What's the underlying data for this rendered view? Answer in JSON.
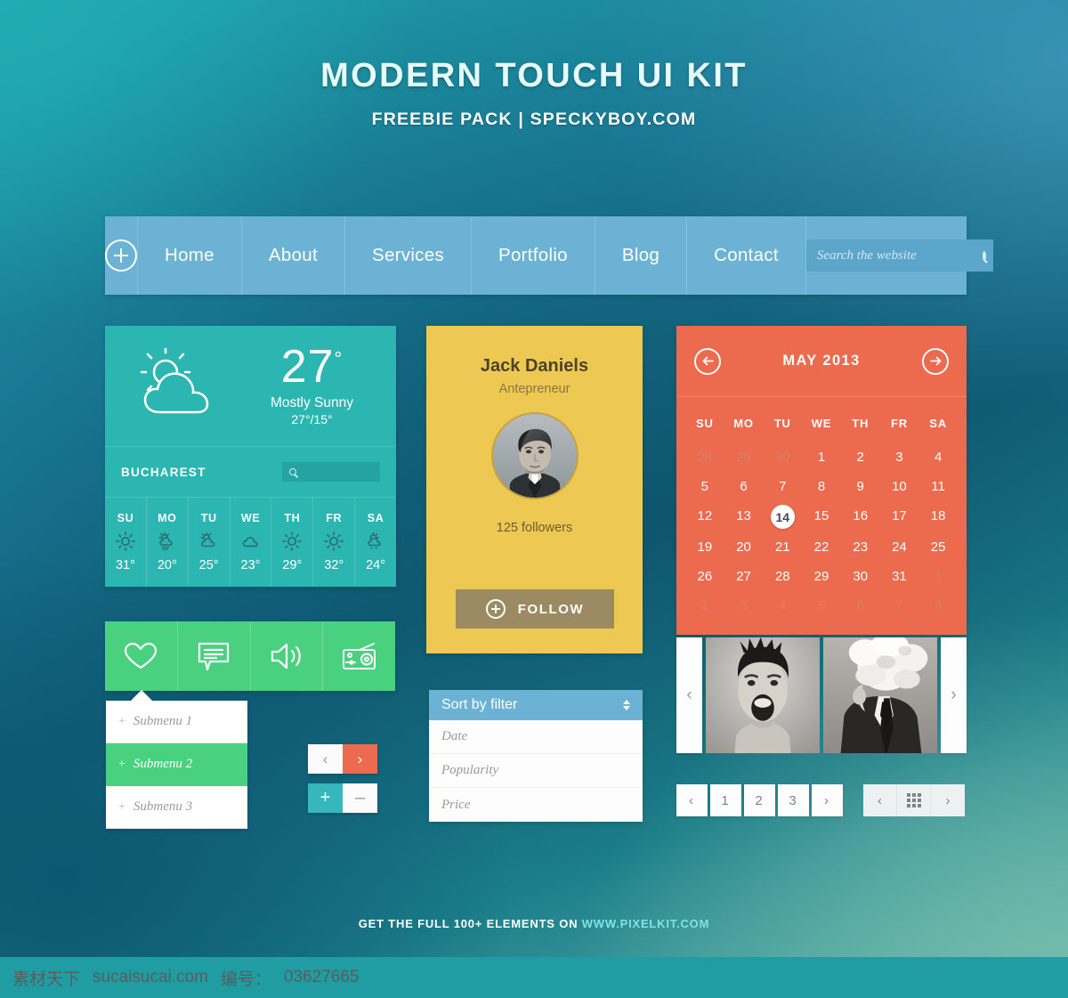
{
  "header": {
    "title": "MODERN TOUCH UI KIT",
    "subtitle": "FREEBIE PACK | SPECKYBOY.COM"
  },
  "nav": {
    "plus_icon": "plus-circle-icon",
    "items": [
      {
        "label": "Home"
      },
      {
        "label": "About"
      },
      {
        "label": "Services"
      },
      {
        "label": "Portfolio"
      },
      {
        "label": "Blog"
      },
      {
        "label": "Contact"
      }
    ],
    "search": {
      "placeholder": "Search the website",
      "value": "",
      "icon": "search-icon"
    },
    "bar_color": "#6cb2d4"
  },
  "weather": {
    "icon": "sun-behind-cloud-icon",
    "temperature": "27",
    "degree": "°",
    "condition": "Mostly Sunny",
    "high_low": "27°/15°",
    "city": "BUCHAREST",
    "search_placeholder": "",
    "search_icon": "search-icon",
    "card_color": "#2cb6b2",
    "days": [
      {
        "day": "SU",
        "icon": "sun-icon",
        "temp": "31°"
      },
      {
        "day": "MO",
        "icon": "sun-rain-icon",
        "temp": "20°"
      },
      {
        "day": "TU",
        "icon": "sun-cloud-icon",
        "temp": "25°"
      },
      {
        "day": "WE",
        "icon": "cloud-icon",
        "temp": "23°"
      },
      {
        "day": "TH",
        "icon": "sun-icon",
        "temp": "29°"
      },
      {
        "day": "FR",
        "icon": "sun-icon",
        "temp": "32°"
      },
      {
        "day": "SA",
        "icon": "sun-cloud-rain-icon",
        "temp": "24°"
      }
    ]
  },
  "profile": {
    "name": "Jack Daniels",
    "role": "Antepreneur",
    "avatar": "user-photo-avatar",
    "followers": "125 followers",
    "follow_label": "FOLLOW",
    "follow_icon": "plus-circle-icon",
    "card_color": "#edc954",
    "button_color": "#9c8a62"
  },
  "calendar": {
    "prev_icon": "arrow-left-circle-icon",
    "next_icon": "arrow-right-circle-icon",
    "title": "MAY 2013",
    "card_color": "#ec6a4d",
    "dow": [
      "SU",
      "MO",
      "TU",
      "WE",
      "TH",
      "FR",
      "SA"
    ],
    "weeks": [
      [
        {
          "d": "28",
          "muted": true
        },
        {
          "d": "29",
          "muted": true
        },
        {
          "d": "30",
          "muted": true
        },
        {
          "d": "1"
        },
        {
          "d": "2"
        },
        {
          "d": "3"
        },
        {
          "d": "4"
        }
      ],
      [
        {
          "d": "5"
        },
        {
          "d": "6"
        },
        {
          "d": "7"
        },
        {
          "d": "8"
        },
        {
          "d": "9"
        },
        {
          "d": "10"
        },
        {
          "d": "11"
        }
      ],
      [
        {
          "d": "12"
        },
        {
          "d": "13"
        },
        {
          "d": "14",
          "selected": true
        },
        {
          "d": "15"
        },
        {
          "d": "16"
        },
        {
          "d": "17"
        },
        {
          "d": "18"
        }
      ],
      [
        {
          "d": "19"
        },
        {
          "d": "20"
        },
        {
          "d": "21"
        },
        {
          "d": "22"
        },
        {
          "d": "23"
        },
        {
          "d": "24"
        },
        {
          "d": "25"
        }
      ],
      [
        {
          "d": "26"
        },
        {
          "d": "27"
        },
        {
          "d": "28"
        },
        {
          "d": "29"
        },
        {
          "d": "30"
        },
        {
          "d": "31"
        },
        {
          "d": "1",
          "muted": true
        }
      ],
      [
        {
          "d": "2",
          "muted": true
        },
        {
          "d": "3",
          "muted": true
        },
        {
          "d": "4",
          "muted": true
        },
        {
          "d": "5",
          "muted": true
        },
        {
          "d": "6",
          "muted": true
        },
        {
          "d": "7",
          "muted": true
        },
        {
          "d": "8",
          "muted": true
        }
      ]
    ]
  },
  "greenbar": {
    "color": "#4ad17f",
    "icons": [
      "heart-icon",
      "chat-bubble-icon",
      "speaker-volume-icon",
      "radio-icon"
    ]
  },
  "submenu": {
    "items": [
      {
        "prefix": "+",
        "label": "Submenu 1",
        "active": false
      },
      {
        "prefix": "+",
        "label": "Submenu 2",
        "active": true
      },
      {
        "prefix": "+",
        "label": "Submenu 3",
        "active": false
      }
    ],
    "active_color": "#4ad17f"
  },
  "steppers": {
    "nav": {
      "prev": "‹",
      "next": "›",
      "next_color": "#ec6a4d"
    },
    "plusminus": {
      "plus": "+",
      "minus": "–",
      "plus_color": "#35b7bd"
    }
  },
  "sort": {
    "header_label": "Sort by filter",
    "header_icon": "sort-updown-icon",
    "header_color": "#6cb2d4",
    "options": [
      {
        "label": "Date"
      },
      {
        "label": "Popularity"
      },
      {
        "label": "Price"
      }
    ]
  },
  "gallery": {
    "prev_icon": "chevron-left-icon",
    "next_icon": "chevron-right-icon",
    "images": [
      "screaming-man-photo",
      "man-with-smoke-head-photo"
    ]
  },
  "pagination": {
    "prev_icon": "chevron-left-icon",
    "next_icon": "chevron-right-icon",
    "pages": [
      "1",
      "2",
      "3"
    ]
  },
  "pagination_grid": {
    "prev_icon": "chevron-left-icon",
    "grid_icon": "grid-view-icon",
    "next_icon": "chevron-right-icon"
  },
  "footer": {
    "text": "GET THE FULL 100+ ELEMENTS ON ",
    "link": "WWW.PIXELKIT.COM",
    "link_color": "#7fe4e0"
  },
  "watermark": {
    "site_cn": "素材天下",
    "site": "sucaisucai.com",
    "id_label": "编号：",
    "id_value": "03627665",
    "bar_color": "#1f9da2"
  }
}
